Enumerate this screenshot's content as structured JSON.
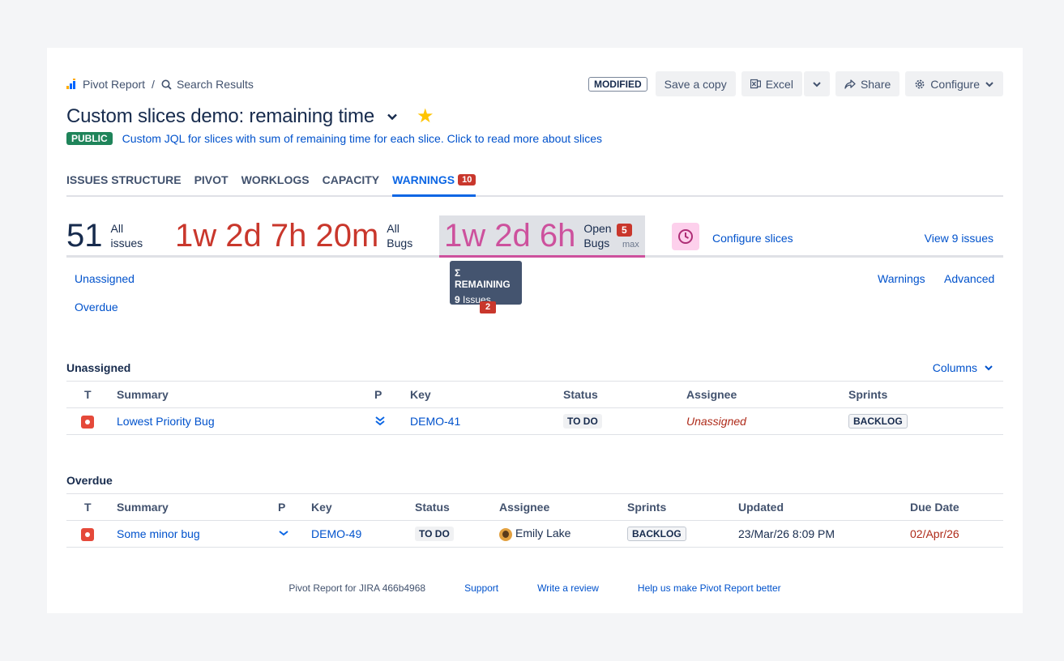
{
  "breadcrumb": {
    "app": "Pivot Report",
    "separator": "/",
    "current": "Search Results"
  },
  "toolbar": {
    "modified": "MODIFIED",
    "save_copy": "Save a copy",
    "excel": "Excel",
    "share": "Share",
    "configure": "Configure"
  },
  "report": {
    "title": "Custom slices demo: remaining time",
    "visibility": "PUBLIC",
    "description": "Custom JQL for slices with sum of remaining time for each slice. Click to read more about slices"
  },
  "tabs": [
    {
      "label": "ISSUES STRUCTURE"
    },
    {
      "label": "PIVOT"
    },
    {
      "label": "WORKLOGS"
    },
    {
      "label": "CAPACITY"
    },
    {
      "label": "WARNINGS",
      "count": "10",
      "active": true
    }
  ],
  "slices": {
    "all_issues": {
      "value": "51",
      "label_line1": "All",
      "label_line2": "issues"
    },
    "all_bugs": {
      "value": "1w 2d 7h 20m",
      "label_line1": "All",
      "label_line2": "Bugs"
    },
    "open_bugs": {
      "value": "1w 2d 6h",
      "label_line1": "Open",
      "label_line2": "Bugs",
      "count": "5",
      "max": "max"
    },
    "configure_slices": "Configure slices",
    "view_issues": "View 9 issues"
  },
  "tooltip": {
    "title": "Σ REMAINING",
    "count": "9",
    "unit": "Issues"
  },
  "sub_badge": "2",
  "subnav": {
    "unassigned": "Unassigned",
    "overdue": "Overdue",
    "warnings": "Warnings",
    "advanced": "Advanced"
  },
  "unassigned_section": {
    "title": "Unassigned",
    "columns_btn": "Columns",
    "headers": [
      "T",
      "Summary",
      "P",
      "Key",
      "Status",
      "Assignee",
      "Sprints"
    ],
    "rows": [
      {
        "summary": "Lowest Priority Bug",
        "priority": "lowest",
        "key": "DEMO-41",
        "status": "TO DO",
        "assignee": "Unassigned",
        "sprint": "BACKLOG"
      }
    ]
  },
  "overdue_section": {
    "title": "Overdue",
    "headers": [
      "T",
      "Summary",
      "P",
      "Key",
      "Status",
      "Assignee",
      "Sprints",
      "Updated",
      "Due Date"
    ],
    "rows": [
      {
        "summary": "Some minor bug",
        "priority": "low",
        "key": "DEMO-49",
        "status": "TO DO",
        "assignee": "Emily Lake",
        "sprint": "BACKLOG",
        "updated": "23/Mar/26 8:09 PM",
        "due": "02/Apr/26"
      }
    ]
  },
  "footer": {
    "version": "Pivot Report for JIRA 466b4968",
    "support": "Support",
    "review": "Write a review",
    "feedback": "Help us make Pivot Report better"
  },
  "colors": {
    "accent": "#0c66e4",
    "danger": "#c9372c",
    "slice_pink": "#cd519d",
    "public_green": "#1f845a"
  }
}
